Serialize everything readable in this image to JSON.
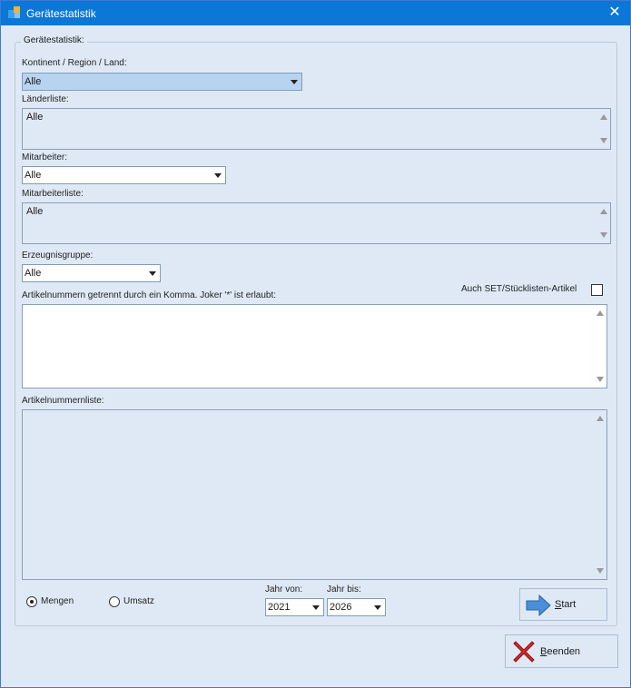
{
  "window": {
    "title": "Gerätestatistik"
  },
  "group": {
    "legend": "Gerätestatistik:"
  },
  "region": {
    "label": "Kontinent / Region / Land:",
    "value": "Alle"
  },
  "countries": {
    "label": "Länderliste:",
    "items": [
      "Alle"
    ]
  },
  "employee": {
    "label": "Mitarbeiter:",
    "value": "Alle"
  },
  "employees": {
    "label": "Mitarbeiterliste:",
    "items": [
      "Alle"
    ]
  },
  "product_group": {
    "label": "Erzeugnisgruppe:",
    "value": "Alle"
  },
  "set_articles": {
    "label": "Auch SET/Stücklisten-Artikel",
    "checked": false
  },
  "article_numbers": {
    "label": "Artikelnummern getrennt durch ein Komma. Joker '*' ist erlaubt:",
    "value": ""
  },
  "article_list": {
    "label": "Artikelnummernliste:"
  },
  "mode": {
    "options": [
      {
        "label": "Mengen",
        "checked": true
      },
      {
        "label": "Umsatz",
        "checked": false
      }
    ]
  },
  "year_from": {
    "label": "Jahr von:",
    "value": "2021"
  },
  "year_to": {
    "label": "Jahr bis:",
    "value": "2026"
  },
  "buttons": {
    "start_prefix": "S",
    "start_rest": "tart",
    "quit_prefix": "B",
    "quit_rest": "eenden"
  },
  "colors": {
    "titlebar": "#0b78d7",
    "window_bg": "#dfe9f5",
    "start_arrow": "#4a90d9",
    "quit_x": "#d42a2a"
  }
}
